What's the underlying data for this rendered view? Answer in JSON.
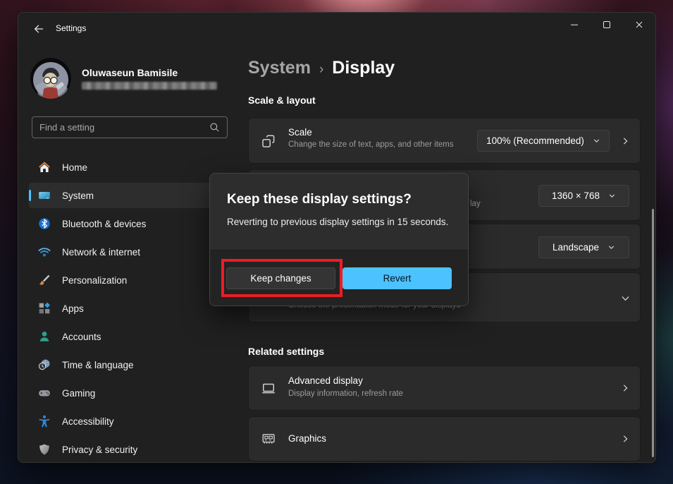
{
  "colors": {
    "accent_blue": "#4cc2ff",
    "annotation_red": "#ed1c24",
    "window_bg": "#202020",
    "card_bg": "#2b2b2b"
  },
  "window": {
    "title": "Settings",
    "controls": [
      "minimize",
      "maximize",
      "close"
    ]
  },
  "profile": {
    "name": "Oluwaseun Bamisile",
    "email_redacted": true
  },
  "search": {
    "placeholder": "Find a setting",
    "icon": "search-icon"
  },
  "sidebar": {
    "selected": "System",
    "items": [
      {
        "label": "Home",
        "icon": "home-icon"
      },
      {
        "label": "System",
        "icon": "system-icon"
      },
      {
        "label": "Bluetooth & devices",
        "icon": "bluetooth-icon"
      },
      {
        "label": "Network & internet",
        "icon": "network-icon"
      },
      {
        "label": "Personalization",
        "icon": "personalization-icon"
      },
      {
        "label": "Apps",
        "icon": "apps-icon"
      },
      {
        "label": "Accounts",
        "icon": "accounts-icon"
      },
      {
        "label": "Time & language",
        "icon": "time-language-icon"
      },
      {
        "label": "Gaming",
        "icon": "gaming-icon"
      },
      {
        "label": "Accessibility",
        "icon": "accessibility-icon"
      },
      {
        "label": "Privacy & security",
        "icon": "privacy-security-icon"
      }
    ]
  },
  "breadcrumb": {
    "parent": "System",
    "separator": "›",
    "current": "Display"
  },
  "sections": {
    "scale_layout": "Scale & layout",
    "related": "Related settings"
  },
  "cards": {
    "scale": {
      "icon": "scale-icon",
      "title": "Scale",
      "description": "Change the size of text, apps, and other items",
      "value": "100% (Recommended)"
    },
    "resolution": {
      "visible_description_fragment": "lay",
      "value": "1360 × 768"
    },
    "orientation": {
      "value": "Landscape"
    },
    "multiple_displays": {
      "description": "Choose the presentation mode for your displays"
    },
    "advanced_display": {
      "icon": "monitor-icon",
      "title": "Advanced display",
      "description": "Display information, refresh rate"
    },
    "graphics": {
      "icon": "graphics-card-icon",
      "title": "Graphics"
    }
  },
  "dialog": {
    "title": "Keep these display settings?",
    "body": "Reverting to previous display settings in 15 seconds.",
    "buttons": {
      "keep": "Keep changes",
      "revert": "Revert"
    }
  }
}
